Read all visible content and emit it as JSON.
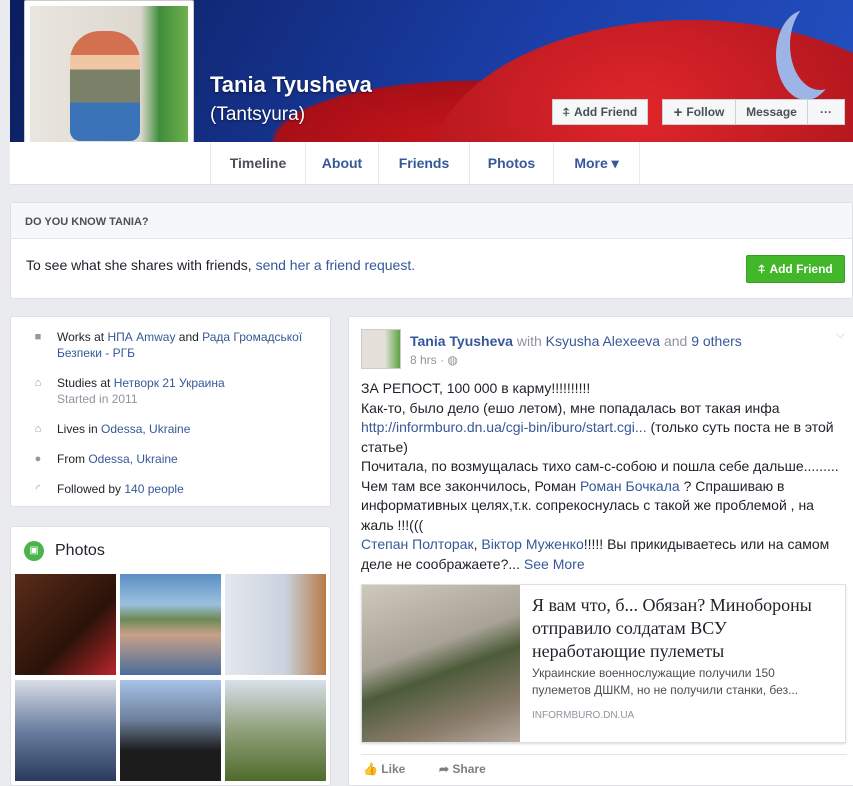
{
  "profile": {
    "name": "Tania Tyusheva",
    "nickname": "(Tantsyura)"
  },
  "actions": {
    "add_friend": "Add Friend",
    "follow": "Follow",
    "message": "Message",
    "more": "···"
  },
  "tabs": [
    {
      "label": "Timeline"
    },
    {
      "label": "About"
    },
    {
      "label": "Friends"
    },
    {
      "label": "Photos"
    },
    {
      "label": "More ▾"
    }
  ],
  "know": {
    "header": "DO YOU KNOW TANIA?",
    "text": "To see what she shares with friends, ",
    "link": "send her a friend request.",
    "button": "Add Friend",
    "button_color": "#42b72a"
  },
  "intro": {
    "works_prefix": "Works at ",
    "works_1": "НПА Amway",
    "works_and": " and ",
    "works_2": "Рада Громадської Безпеки - РГБ",
    "studies_prefix": "Studies at ",
    "studies": "Нетворк 21 Украина",
    "studies_sub": "Started in 2011",
    "lives_prefix": "Lives in ",
    "lives": "Odessa, Ukraine",
    "from_prefix": "From ",
    "from": "Odessa, Ukraine",
    "followed_prefix": "Followed by ",
    "followed": "140 people"
  },
  "photos": {
    "title": "Photos"
  },
  "post": {
    "author": "Tania Tyusheva",
    "with": " with ",
    "tagged": "Ksyusha Alexeeva",
    "and": " and ",
    "others": "9 others",
    "time": "8 hrs",
    "dot": " · ",
    "l1": "ЗА РЕПОСТ, 100 000 в карму!!!!!!!!!!",
    "l2": "Как-то, было дело (ешо летом), мне попадалась вот такая инфа ",
    "url": "http://informburo.dn.ua/cgi-bin/iburo/start.cgi...",
    "l3": " (только суть поста не в этой статье)",
    "l4": "Почитала, по возмущалась тихо сам-с-собою и пошла себе дальше.........",
    "l5a": "Чем там все закончилось, Роман ",
    "mention1": "Роман Бочкала",
    "l5b": " ? Спрашиваю в информативных целях,т.к. сопрекоснулась с такой же проблемой , на жаль !!!(((",
    "mention2": "Степан Полторак",
    "comma": ", ",
    "mention3": "Віктор Муженко",
    "l6": "!!!!! Вы прикидываетесь или на самом деле не соображаете?... ",
    "see_more": "See More",
    "link_title": "Я вам что, б... Обязан? Минобороны отправило солдатам ВСУ неработающие пулеметы",
    "link_desc": "Украинские военнослужащие получили 150 пулеметов ДШКМ, но не получили станки, без...",
    "link_domain": "INFORMBURO.DN.UA",
    "like": "Like",
    "share": "Share"
  }
}
